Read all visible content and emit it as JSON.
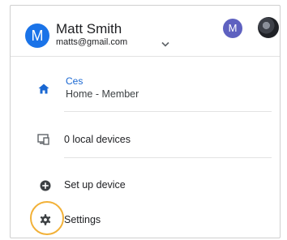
{
  "account": {
    "avatar_letter": "M",
    "name": "Matt Smith",
    "email": "matts@gmail.com",
    "secondary_avatar_letter": "M"
  },
  "home": {
    "title": "Ces",
    "subtitle": "Home - Member"
  },
  "devices": {
    "label": "0 local devices"
  },
  "menu": {
    "setup_label": "Set up device",
    "settings_label": "Settings"
  },
  "colors": {
    "accent": "#1a73e8",
    "home_link": "#1967d2",
    "secondary_avatar": "#5e61c0",
    "highlight_ring": "#f2b138"
  }
}
